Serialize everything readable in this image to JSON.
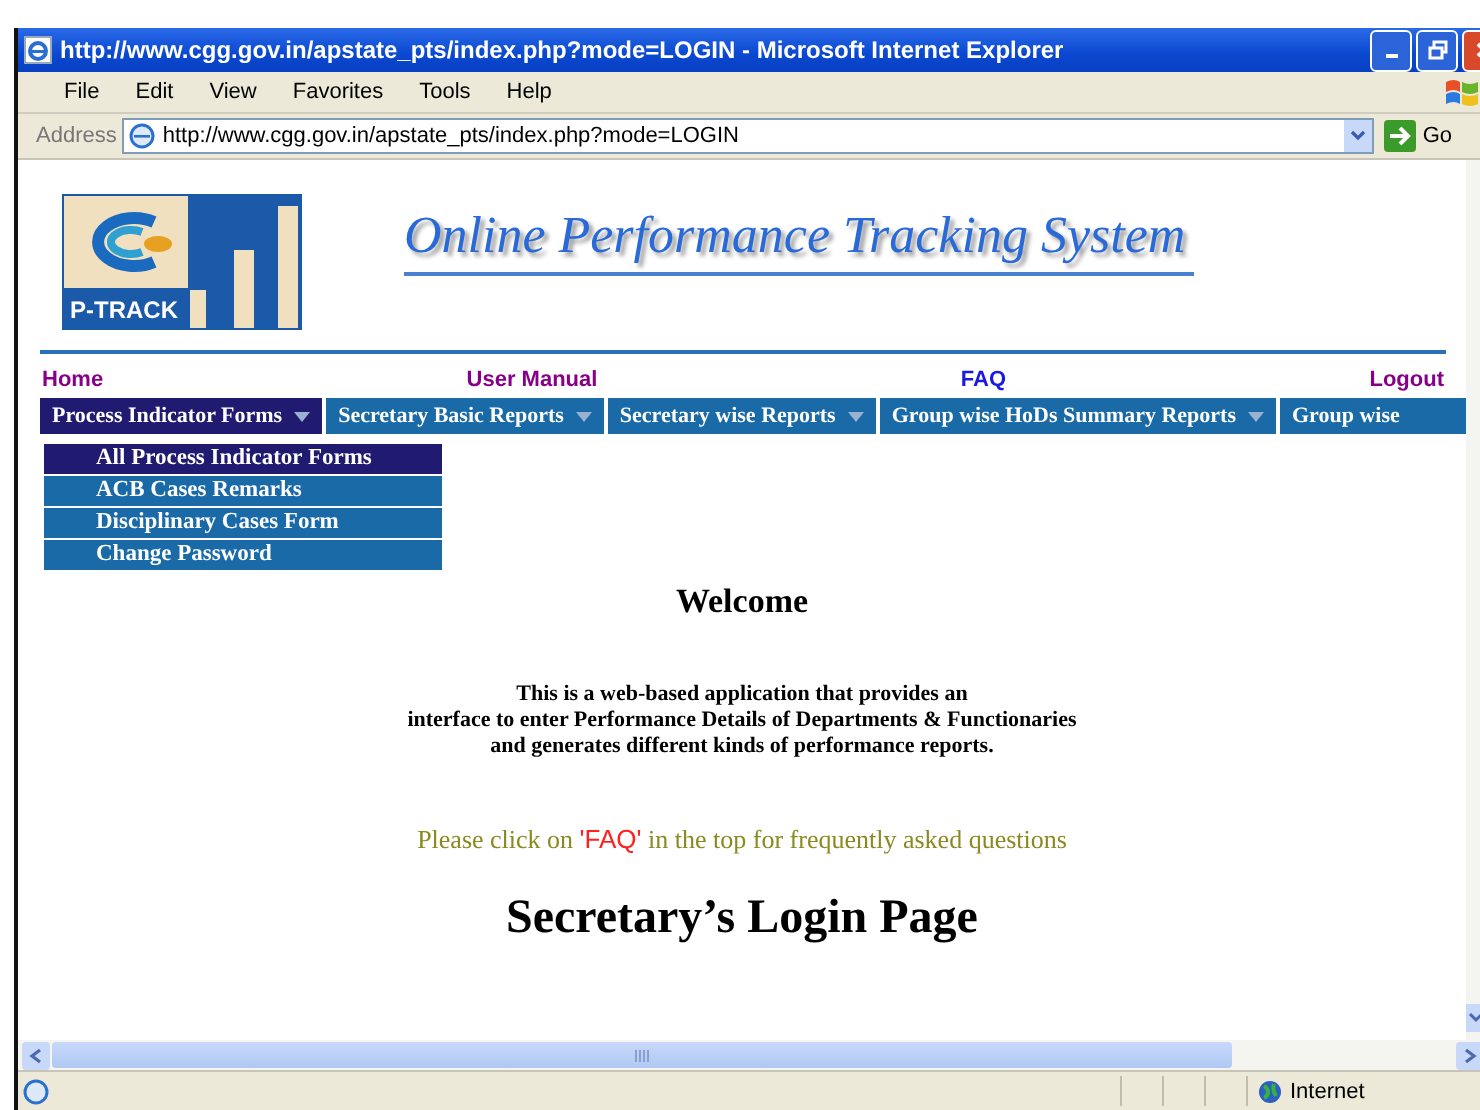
{
  "window": {
    "title": "http://www.cgg.gov.in/apstate_pts/index.php?mode=LOGIN - Microsoft Internet Explorer"
  },
  "menu_bar": [
    "File",
    "Edit",
    "View",
    "Favorites",
    "Tools",
    "Help"
  ],
  "address_bar": {
    "label": "Address",
    "value": "http://www.cgg.gov.in/apstate_pts/index.php?mode=LOGIN",
    "go": "Go"
  },
  "page": {
    "logo": {
      "text": "P-TRACK"
    },
    "heading": "Online Performance Tracking System",
    "nav_links": [
      {
        "label": "Home",
        "visited": true
      },
      {
        "label": "User Manual",
        "visited": true
      },
      {
        "label": "FAQ",
        "visited": false
      },
      {
        "label": "Logout",
        "visited": true
      }
    ],
    "menu_tabs": [
      {
        "label": "Process Indicator Forms",
        "selected": true,
        "has_arrow": true
      },
      {
        "label": "Secretary Basic Reports",
        "selected": false,
        "has_arrow": true
      },
      {
        "label": "Secretary wise Reports",
        "selected": false,
        "has_arrow": true
      },
      {
        "label": "Group wise HoDs Summary Reports",
        "selected": false,
        "has_arrow": true
      },
      {
        "label": "Group wise",
        "selected": false,
        "has_arrow": false
      }
    ],
    "dropdown": [
      {
        "label": "All Process Indicator Forms",
        "selected": true
      },
      {
        "label": "ACB Cases Remarks",
        "selected": false
      },
      {
        "label": "Disciplinary Cases Form",
        "selected": false
      },
      {
        "label": "Change Password",
        "selected": false
      }
    ],
    "welcome": "Welcome",
    "description": [
      "This is a web-based application that provides an",
      "interface to enter Performance Details of Departments & Functionaries",
      "and generates different kinds of performance reports."
    ],
    "faq_note": {
      "before": "Please click on ",
      "link": "'FAQ'",
      "after": " in the top for frequently asked questions"
    },
    "login_heading": "Secretary’s Login Page"
  },
  "status_bar": {
    "zone": "Internet"
  }
}
